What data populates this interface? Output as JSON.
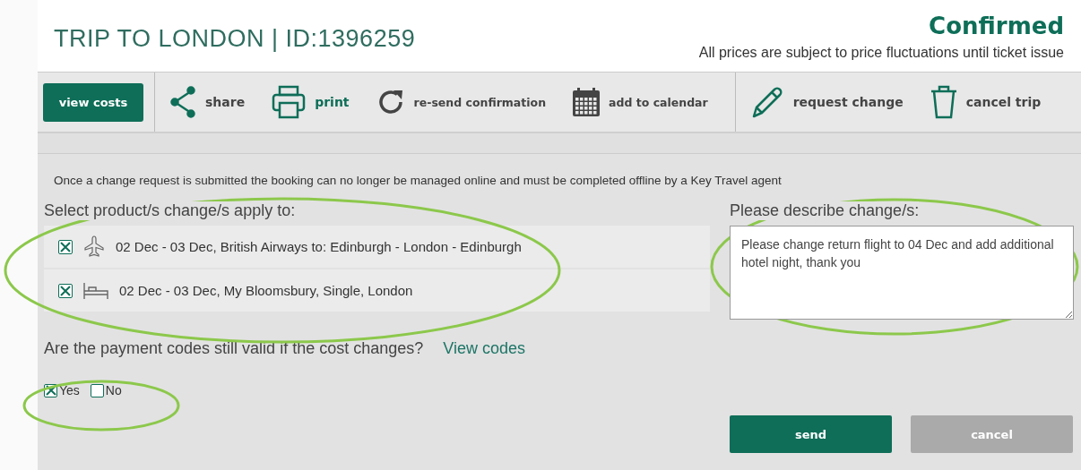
{
  "header": {
    "title": "TRIP TO LONDON | ID:1396259",
    "status": "Confirmed",
    "note": "All prices are subject to price fluctuations until ticket issue"
  },
  "toolbar": [
    {
      "kind": "primary",
      "label": "view costs"
    },
    {
      "kind": "share",
      "label": "share",
      "highlighted": false
    },
    {
      "kind": "print",
      "label": "print",
      "highlighted": true
    },
    {
      "kind": "resend",
      "label": "re-send confirmation",
      "highlighted": false
    },
    {
      "kind": "calendar",
      "label": "add to calendar",
      "highlighted": false
    },
    {
      "kind": "edit",
      "label": "request change",
      "highlighted": false
    },
    {
      "kind": "trash",
      "label": "cancel trip",
      "highlighted": false
    }
  ],
  "notice": "Once a change request is submitted the booking can no longer be managed online and must be completed offline by a Key Travel agent",
  "products": {
    "label": "Select product/s change/s apply to:",
    "items": [
      {
        "kind": "flight",
        "text": "02 Dec - 03 Dec, British Airways to: Edinburgh - London - Edinburgh",
        "checked": true
      },
      {
        "kind": "hotel",
        "text": "02 Dec - 03 Dec, My Bloomsbury, Single, London",
        "checked": true
      }
    ]
  },
  "description": {
    "label": "Please describe change/s:",
    "value": "Please change return flight to 04 Dec and add additional hotel night, thank you"
  },
  "payment": {
    "question": "Are the payment codes still valid if the cost changes?",
    "link": "View codes",
    "options": [
      {
        "label": "Yes",
        "checked": true
      },
      {
        "label": "No",
        "checked": false
      }
    ]
  },
  "buttons": [
    {
      "kind": "primary",
      "label": "send"
    },
    {
      "kind": "secondary",
      "label": "cancel"
    }
  ]
}
